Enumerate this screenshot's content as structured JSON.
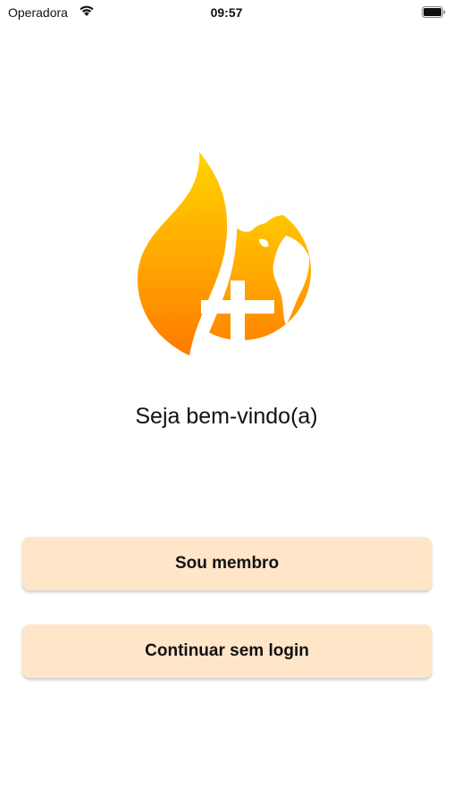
{
  "status_bar": {
    "carrier": "Operadora",
    "time": "09:57",
    "wifi_icon": "wifi-icon",
    "battery_icon": "battery-icon"
  },
  "logo": {
    "icon": "flame-globe-cross-logo",
    "colors": {
      "top": "#ffd400",
      "bottom": "#ff8000",
      "cross": "#ffffff"
    }
  },
  "welcome": {
    "title": "Seja bem-vindo(a)"
  },
  "actions": {
    "member_label": "Sou membro",
    "guest_label": "Continuar sem login",
    "button_color": "#ffe6c9"
  }
}
